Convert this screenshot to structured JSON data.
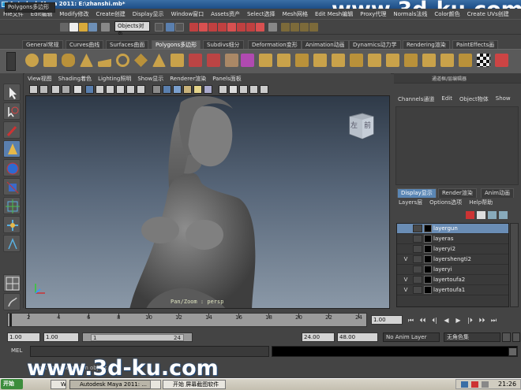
{
  "window": {
    "title": "Autodesk Maya 2011: E:\\zhanshi.mb*"
  },
  "watermark": "www.3d-ku.com",
  "menubar": [
    "File文件",
    "Edit编辑",
    "Modify修改",
    "Create创建",
    "Display显示",
    "Window窗口",
    "Assets资产",
    "Select选择",
    "Mesh网格",
    "Edit Mesh编辑",
    "Proxy代理",
    "Normals法线",
    "Color颜色",
    "Create UVs创建"
  ],
  "statusline": {
    "mode": "Polygons多边形",
    "objects_field": "Objects对象"
  },
  "shelf_tabs": [
    "General常规",
    "Curves曲线",
    "Surfaces曲面",
    "Polygons多边形",
    "Subdivs细分",
    "Deformation变形",
    "Animation动画",
    "Dynamics动力学",
    "Rendering渲染",
    "PaintEffects画"
  ],
  "shelf_active": "Polygons多边形",
  "viewport": {
    "menu": [
      "View视图",
      "Shading着色",
      "Lighting照明",
      "Show显示",
      "Renderer渲染",
      "Panels面板"
    ],
    "camera_label": "Pan/Zoom : persp",
    "viewcube": {
      "left": "左",
      "front": "前"
    }
  },
  "channel_box": {
    "title": "通道框/层编辑器",
    "menu": [
      "Channels通道",
      "Edit",
      "Object物体",
      "Show"
    ]
  },
  "layer_editor": {
    "tabs": [
      "Display显示",
      "Render渲染",
      "Anim动画"
    ],
    "active_tab": "Display显示",
    "menu": [
      "Layers层",
      "Options选项",
      "Help帮助"
    ],
    "layers": [
      {
        "vis": "",
        "name": "layergun",
        "selected": true
      },
      {
        "vis": "",
        "name": "layeras",
        "selected": false
      },
      {
        "vis": "",
        "name": "layeryi2",
        "selected": false
      },
      {
        "vis": "V",
        "name": "layershengti2",
        "selected": false
      },
      {
        "vis": "",
        "name": "layeryi",
        "selected": false
      },
      {
        "vis": "V",
        "name": "layertoufa2",
        "selected": false
      },
      {
        "vis": "V",
        "name": "layertoufa1",
        "selected": false
      }
    ]
  },
  "timeslider": {
    "ticks": [
      "2",
      "4",
      "6",
      "8",
      "10",
      "12",
      "14",
      "16",
      "18",
      "20",
      "22",
      "24"
    ],
    "current_frame": "1.00",
    "playback": [
      "⏮",
      "⏴⏴",
      "⏴|",
      "◀",
      "▶",
      "|⏵",
      "⏵⏵",
      "⏭"
    ]
  },
  "rangebar": {
    "start_time": "1.00",
    "playback_start": "1.00",
    "range_start": "1",
    "range_end": "24",
    "playback_end": "24.00",
    "end_time": "48.00",
    "anim_layer": "No Anim Layer",
    "character_set": "无角色集"
  },
  "cmdline": {
    "label": "MEL",
    "help": "Select Tool: select an object"
  },
  "taskbar": {
    "start": "开始",
    "tasks": [
      "W",
      "Autodesk Maya 2011: ...",
      "F",
      "开始  屏幕截图软件"
    ],
    "clock": "21:26"
  },
  "colors": {
    "layer_selected": "#6a8db5",
    "tab_active": "#5a86b4",
    "viewport_top": "#2f3a48",
    "viewport_bottom": "#8a98a7"
  }
}
